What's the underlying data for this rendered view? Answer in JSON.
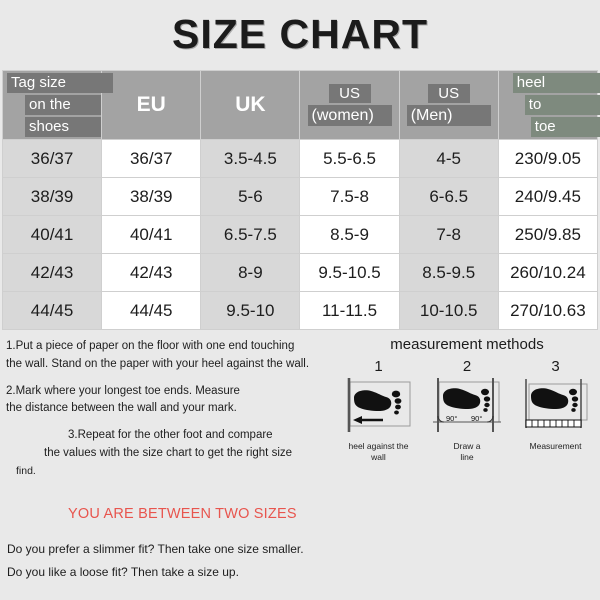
{
  "title": "SIZE CHART",
  "table": {
    "headers": [
      {
        "type": "stacked",
        "lines": [
          "Tag size",
          "on the",
          "shoes"
        ],
        "tint": "gray"
      },
      {
        "type": "plain",
        "label": "EU"
      },
      {
        "type": "plain",
        "label": "UK"
      },
      {
        "type": "stacked",
        "lines": [
          "US",
          "(women)"
        ],
        "tint": "gray"
      },
      {
        "type": "stacked",
        "lines": [
          "US",
          "(Men)"
        ],
        "tint": "gray"
      },
      {
        "type": "stacked",
        "lines": [
          "heel",
          "to",
          "toe"
        ],
        "tint": "green"
      }
    ],
    "rows": [
      [
        "36/37",
        "36/37",
        "3.5-4.5",
        "5.5-6.5",
        "4-5",
        "230/9.05"
      ],
      [
        "38/39",
        "38/39",
        "5-6",
        "7.5-8",
        "6-6.5",
        "240/9.45"
      ],
      [
        "40/41",
        "40/41",
        "6.5-7.5",
        "8.5-9",
        "7-8",
        "250/9.85"
      ],
      [
        "42/43",
        "42/43",
        "8-9",
        "9.5-10.5",
        "8.5-9.5",
        "260/10.24"
      ],
      [
        "44/45",
        "44/45",
        "9.5-10",
        "11-11.5",
        "10-10.5",
        "270/10.63"
      ]
    ]
  },
  "instructions": {
    "step1_line1": "1.Put a piece of paper on the floor with one end touching",
    "step1_line2": "the wall. Stand on the paper with your heel against the wall.",
    "step2_line1": "2.Mark where your longest toe ends. Measure",
    "step2_line2": "the distance between the wall and your mark.",
    "step3_line1": "3.Repeat for the other foot and compare",
    "step3_line2": "the values with the size chart to get the right size",
    "step3_line3": "find."
  },
  "methods": {
    "title": "measurement methods",
    "diagrams": [
      {
        "number": "1",
        "caption_line1": "heel against the",
        "caption_line2": "wall",
        "angle_label": ""
      },
      {
        "number": "2",
        "caption_line1": "Draw a",
        "caption_line2": "line",
        "angle_label": "90°"
      },
      {
        "number": "3",
        "caption_line1": "Measurement",
        "caption_line2": "",
        "angle_label": ""
      }
    ]
  },
  "bottom": {
    "between_sizes": "YOU ARE BETWEEN TWO SIZES",
    "fit_line1": "Do you prefer a slimmer fit? Then take one size smaller.",
    "fit_line2": "Do you like a loose fit? Then take a size up.",
    "accent_color": "#e8554e"
  }
}
